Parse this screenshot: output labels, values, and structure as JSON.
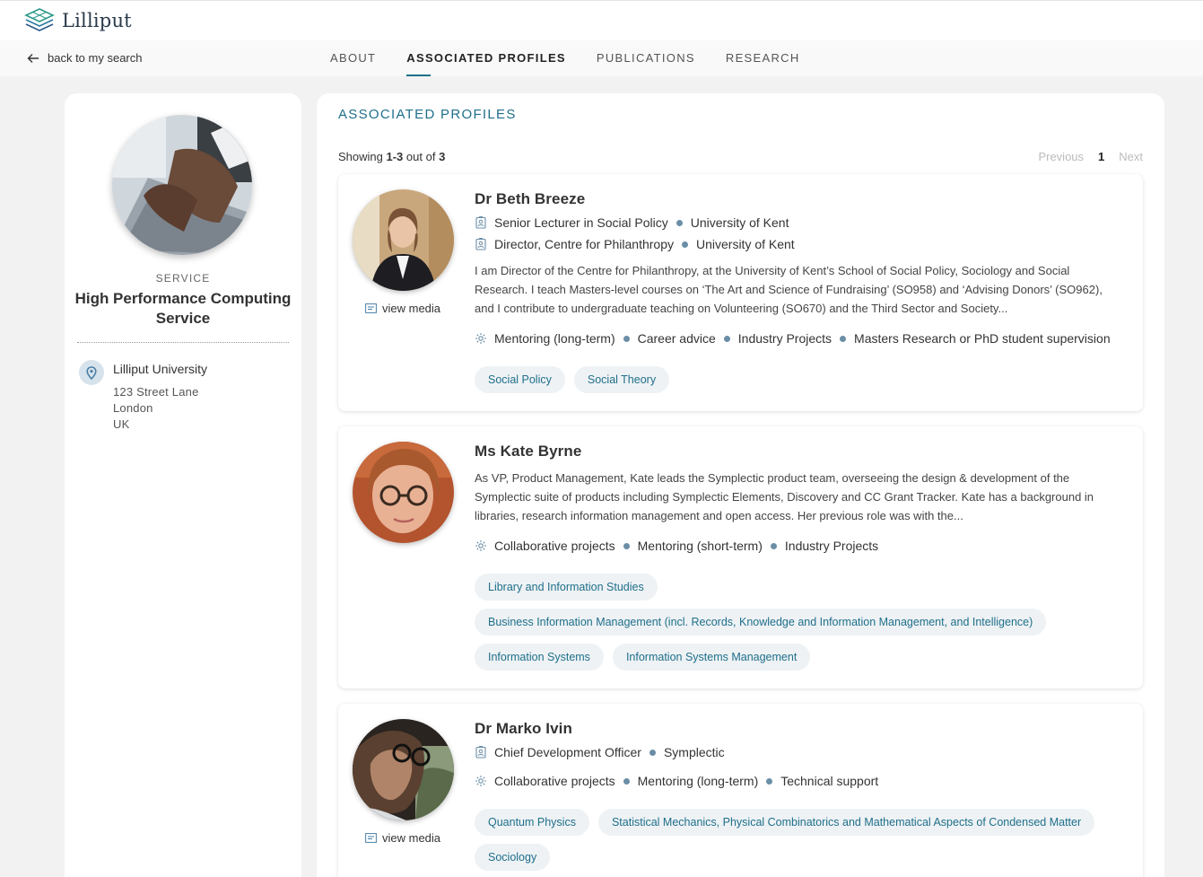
{
  "brand": {
    "name": "Lilliput"
  },
  "nav": {
    "back_label": "back to my search",
    "tabs": [
      {
        "label": "ABOUT"
      },
      {
        "label": "ASSOCIATED PROFILES",
        "active": true
      },
      {
        "label": "PUBLICATIONS"
      },
      {
        "label": "RESEARCH"
      }
    ]
  },
  "entity": {
    "kind": "SERVICE",
    "title": "High Performance Computing Service",
    "organisation": "Lilliput University",
    "address": [
      "123 Street Lane",
      "London",
      "UK"
    ]
  },
  "section": {
    "title": "ASSOCIATED PROFILES",
    "showing_prefix": "Showing",
    "showing_range": "1-3",
    "showing_mid": "out of",
    "showing_total": "3",
    "pager": {
      "previous": "Previous",
      "current": "1",
      "next": "Next"
    }
  },
  "view_media_label": "view media",
  "profiles": [
    {
      "name": "Dr Beth Breeze",
      "positions": [
        {
          "title": "Senior Lecturer in Social Policy",
          "org": "University of Kent"
        },
        {
          "title": "Director, Centre for Philanthropy",
          "org": "University of Kent"
        }
      ],
      "bio": "I am Director of the Centre for Philanthropy, at the University of Kent’s School of Social Policy, Sociology and Social Research. I teach Masters-level courses on ‘The Art and Science of Fundraising’ (SO958) and ‘Advising Donors’ (SO962), and I contribute to undergraduate teaching on Volunteering (SO670) and the Third Sector and Society...",
      "offers": [
        "Mentoring (long-term)",
        "Career advice",
        "Industry Projects",
        "Masters Research or PhD student supervision"
      ],
      "tags": [
        "Social Policy",
        "Social Theory"
      ]
    },
    {
      "name": "Ms Kate Byrne",
      "positions": [],
      "bio": "As VP, Product Management, Kate leads the Symplectic product team, overseeing the design & development of the Symplectic suite of products including Symplectic Elements, Discovery and CC Grant Tracker. Kate has a background in libraries, research information management and open access. Her previous role was with the...",
      "offers": [
        "Collaborative projects",
        "Mentoring (short-term)",
        "Industry Projects"
      ],
      "tags": [
        "Library and Information Studies",
        "Business Information Management (incl. Records, Knowledge and Information Management, and Intelligence)",
        "Information Systems",
        "Information Systems Management"
      ]
    },
    {
      "name": "Dr Marko Ivin",
      "positions": [
        {
          "title": "Chief Development Officer",
          "org": "Symplectic"
        }
      ],
      "bio": "",
      "offers": [
        "Collaborative projects",
        "Mentoring (long-term)",
        "Technical support"
      ],
      "tags": [
        "Quantum Physics",
        "Statistical Mechanics, Physical Combinatorics and Mathematical Aspects of Condensed Matter",
        "Sociology"
      ]
    }
  ],
  "colors": {
    "accent": "#1f6f8b",
    "tag_bg": "#eef2f4",
    "dot": "#6b8ea7"
  }
}
